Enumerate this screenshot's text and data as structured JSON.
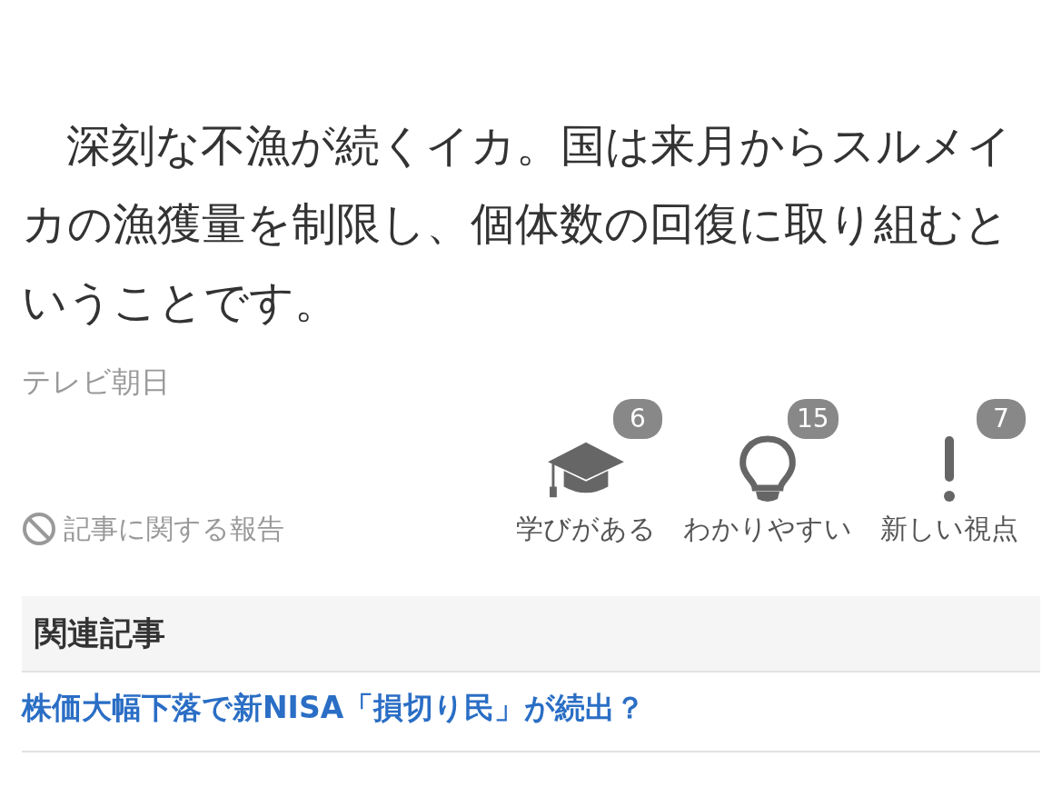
{
  "article": {
    "body": "深刻な不漁が続くイカ。国は来月からスルメイカの漁獲量を制限し、個体数の回復に取り組むということです。",
    "source": "テレビ朝日"
  },
  "report_link": "記事に関する報告",
  "reactions": [
    {
      "kind": "learn",
      "label": "学びがある",
      "count": "6"
    },
    {
      "kind": "clear",
      "label": "わかりやすい",
      "count": "15"
    },
    {
      "kind": "new",
      "label": "新しい視点",
      "count": "7"
    }
  ],
  "related": {
    "title": "関連記事",
    "items": [
      "株価大幅下落で新NISA「損切り民」が続出？"
    ]
  }
}
